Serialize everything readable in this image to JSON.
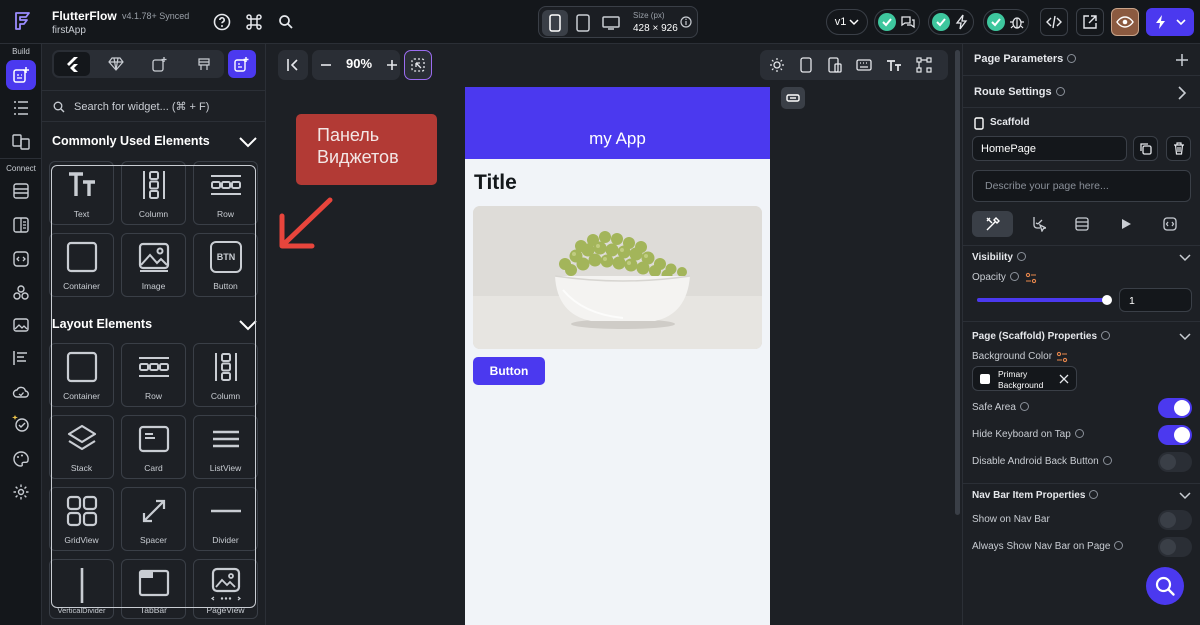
{
  "topbar": {
    "app_name": "FlutterFlow",
    "version": "v4.1.78+ Synced",
    "project_name": "firstApp",
    "size_label": "Size (px)",
    "size_value": "428 × 926",
    "version_select": "v1"
  },
  "rail": {
    "build_label": "Build",
    "connect_label": "Connect"
  },
  "widget_panel": {
    "search_placeholder": "Search for widget... (⌘ + F)",
    "common_title": "Commonly Used Elements",
    "common_items": [
      "Text",
      "Column",
      "Row",
      "Container",
      "Image",
      "Button"
    ],
    "layout_title": "Layout Elements",
    "layout_items": [
      "Container",
      "Row",
      "Column",
      "Stack",
      "Card",
      "ListView",
      "GridView",
      "Spacer",
      "Divider",
      "VerticalDivider",
      "TabBar",
      "PageView"
    ],
    "button_icon_text": "BTN"
  },
  "canvas": {
    "zoom": "90%",
    "annotation": "Панель Виджетов",
    "app_bar_title": "my App",
    "page_title": "Title",
    "button_label": "Button"
  },
  "right_panel": {
    "page_parameters": "Page Parameters",
    "route_settings": "Route Settings",
    "scaffold_label": "Scaffold",
    "page_name": "HomePage",
    "describe_placeholder": "Describe your page here...",
    "visibility": "Visibility",
    "opacity": "Opacity",
    "opacity_value": "1",
    "opacity_fraction": 1.0,
    "scaffold_properties": "Page (Scaffold) Properties",
    "background_color_label": "Background Color",
    "background_color_value": "Primary Background",
    "safe_area": "Safe Area",
    "hide_keyboard": "Hide Keyboard on Tap",
    "disable_back": "Disable Android Back Button",
    "nav_bar_props": "Nav Bar Item Properties",
    "show_on_nav": "Show on Nav Bar",
    "always_show_nav": "Always Show Nav Bar on Page"
  },
  "colors": {
    "accent": "#4b39ef",
    "annotation_bg": "#b23a35",
    "status_ok": "#3ec79e",
    "panel_bg": "#1d2025"
  }
}
